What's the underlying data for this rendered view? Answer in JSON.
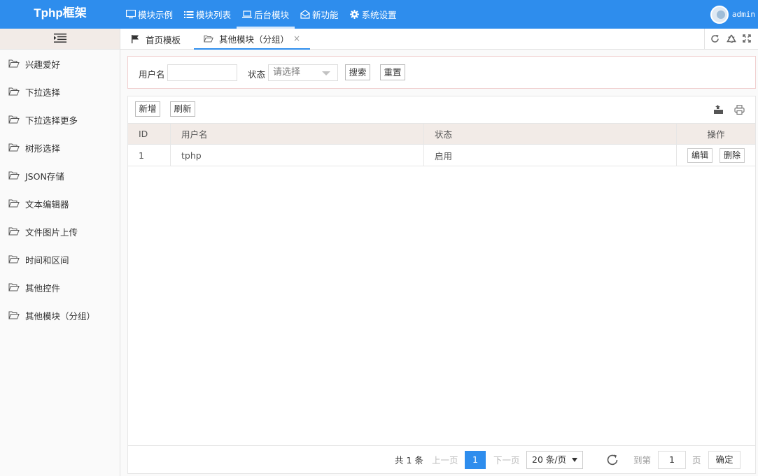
{
  "app": {
    "title": "Tphp框架"
  },
  "topnav": {
    "items": [
      {
        "label": "模块示例",
        "icon": "monitor-icon"
      },
      {
        "label": "模块列表",
        "icon": "list-icon"
      },
      {
        "label": "后台模块",
        "icon": "laptop-icon",
        "active": true
      },
      {
        "label": "新功能",
        "icon": "envelope-open-icon"
      },
      {
        "label": "系统设置",
        "icon": "gear-icon"
      }
    ],
    "user": {
      "name": "admin"
    }
  },
  "sidebar": {
    "items": [
      {
        "label": "兴趣爱好"
      },
      {
        "label": "下拉选择"
      },
      {
        "label": "下拉选择更多"
      },
      {
        "label": "树形选择"
      },
      {
        "label": "JSON存储"
      },
      {
        "label": "文本编辑器"
      },
      {
        "label": "文件图片上传"
      },
      {
        "label": "时间和区间"
      },
      {
        "label": "其他控件"
      },
      {
        "label": "其他模块（分组）"
      }
    ]
  },
  "tabs": {
    "items": [
      {
        "label": "首页模板",
        "icon": "flag-icon"
      },
      {
        "label": "其他模块（分组）",
        "icon": "folder-open-icon",
        "active": true,
        "close": "×"
      }
    ]
  },
  "search": {
    "username_label": "用户名",
    "username_value": "",
    "status_label": "状态",
    "status_placeholder": "请选择",
    "search_button": "搜索",
    "reset_button": "重置"
  },
  "toolbar": {
    "add_button": "新增",
    "refresh_button": "刷新"
  },
  "table": {
    "columns": [
      "ID",
      "用户名",
      "状态",
      "操作"
    ],
    "rows": [
      {
        "id": "1",
        "username": "tphp",
        "status": "启用",
        "edit": "编辑",
        "delete": "删除"
      }
    ]
  },
  "pager": {
    "total": "共 1 条",
    "prev": "上一页",
    "current": "1",
    "next": "下一页",
    "page_size": "20 条/页",
    "goto_label": "到第",
    "goto_value": "1",
    "page_unit": "页",
    "confirm": "确定"
  },
  "colors": {
    "primary": "#2e8ded",
    "header_bg": "#f2ebe7"
  }
}
